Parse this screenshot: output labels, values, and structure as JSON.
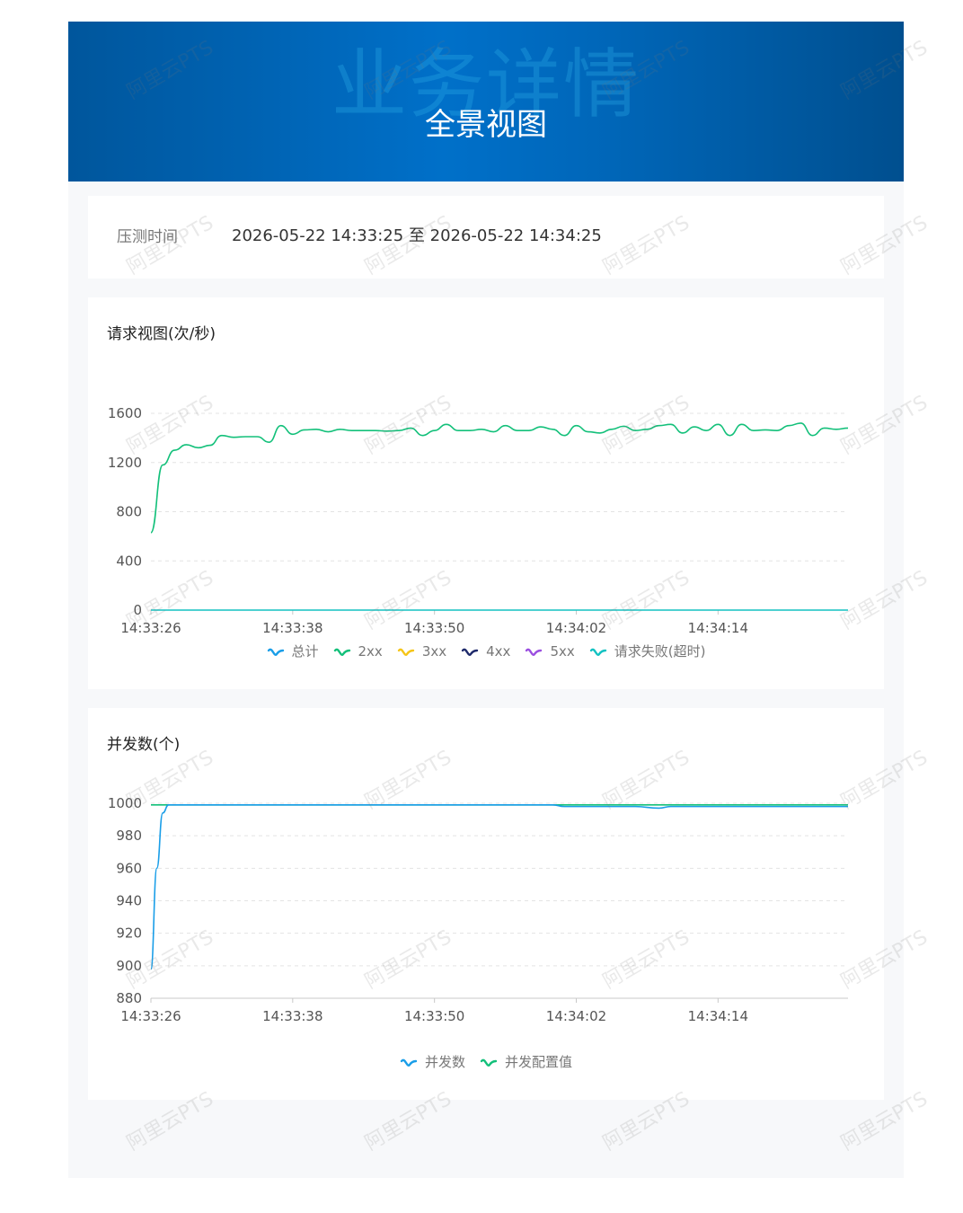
{
  "banner": {
    "bg_title": "业务详情",
    "title": "全景视图"
  },
  "time": {
    "label": "压测时间",
    "value": "2026-05-22 14:33:25 至 2026-05-22 14:34:25"
  },
  "watermark": "阿里云PTS",
  "colors": {
    "total": "#1a9ee8",
    "2xx": "#13c07a",
    "3xx": "#f5c518",
    "4xx": "#1f2a6b",
    "5xx": "#9b4fe0",
    "timeout": "#13c2c2",
    "concurrency": "#1a9ee8",
    "concurrency_config": "#13c07a"
  },
  "chart_data": [
    {
      "type": "line",
      "title": "请求视图(次/秒)",
      "x_ticks": [
        "14:33:26",
        "14:33:38",
        "14:33:50",
        "14:34:02",
        "14:34:14"
      ],
      "x_range": [
        0,
        59
      ],
      "ylim": [
        0,
        1600
      ],
      "y_ticks": [
        0,
        400,
        800,
        1200,
        1600
      ],
      "grid": true,
      "legend_position": "bottom",
      "legend": [
        "总计",
        "2xx",
        "3xx",
        "4xx",
        "5xx",
        "请求失败(超时)"
      ],
      "series": [
        {
          "name": "2xx",
          "x": [
            0,
            1,
            2,
            3,
            4,
            5,
            6,
            7,
            8,
            9,
            10,
            11,
            12,
            13,
            14,
            15,
            16,
            17,
            18,
            19,
            20,
            21,
            22,
            23,
            24,
            25,
            26,
            27,
            28,
            29,
            30,
            31,
            32,
            33,
            34,
            35,
            36,
            37,
            38,
            39,
            40,
            41,
            42,
            43,
            44,
            45,
            46,
            47,
            48,
            49,
            50,
            51,
            52,
            53,
            54,
            55,
            56,
            57,
            58,
            59
          ],
          "values": [
            630,
            1180,
            1300,
            1345,
            1320,
            1340,
            1420,
            1405,
            1410,
            1410,
            1365,
            1500,
            1430,
            1465,
            1470,
            1450,
            1470,
            1460,
            1460,
            1460,
            1455,
            1460,
            1480,
            1420,
            1460,
            1510,
            1460,
            1460,
            1470,
            1450,
            1500,
            1460,
            1460,
            1490,
            1470,
            1420,
            1500,
            1450,
            1440,
            1470,
            1495,
            1460,
            1470,
            1500,
            1510,
            1440,
            1490,
            1460,
            1510,
            1420,
            1510,
            1460,
            1465,
            1460,
            1500,
            1520,
            1420,
            1480,
            1470,
            1480
          ]
        },
        {
          "name": "请求失败(超时)",
          "x": [
            0,
            59
          ],
          "values": [
            0,
            0
          ]
        }
      ]
    },
    {
      "type": "line",
      "title": "并发数(个)",
      "x_ticks": [
        "14:33:26",
        "14:33:38",
        "14:33:50",
        "14:34:02",
        "14:34:14"
      ],
      "x_range": [
        0,
        59
      ],
      "ylim": [
        880,
        1000
      ],
      "y_ticks": [
        880,
        900,
        920,
        940,
        960,
        980,
        1000
      ],
      "grid": true,
      "legend_position": "bottom",
      "legend": [
        "并发数",
        "并发配置值"
      ],
      "series": [
        {
          "name": "并发数",
          "x": [
            0,
            0.5,
            1,
            1.5,
            2,
            5,
            10,
            20,
            30,
            34,
            35,
            36,
            40,
            41,
            43,
            44,
            45,
            46,
            48,
            50,
            55,
            59
          ],
          "values": [
            898,
            960,
            994,
            999,
            999,
            999,
            999,
            999,
            999,
            999,
            998,
            998,
            998,
            998,
            997,
            998,
            998,
            998,
            998,
            998,
            998,
            998
          ]
        },
        {
          "name": "并发配置值",
          "x": [
            0,
            59
          ],
          "values": [
            999,
            999
          ]
        }
      ]
    }
  ]
}
